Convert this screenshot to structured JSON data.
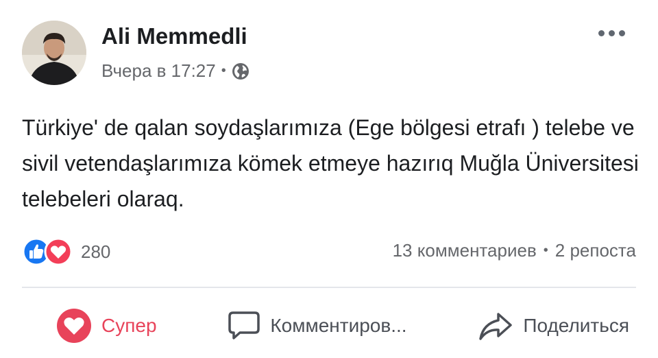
{
  "post": {
    "author": "Ali Memmedli",
    "time": "Вчера в 17:27",
    "separator": "•",
    "privacy_icon": "globe-icon",
    "text": "Türkiye' de qalan soydaşlarımıza (Ege bölgesi etrafı ) telebe ve sivil vetendaşlarımıza kömek etmeye hazırıq Muğla Üniversitesi telebeleri olaraq."
  },
  "reactions": {
    "icons": [
      "like-icon",
      "love-icon"
    ],
    "count": "280"
  },
  "stats": {
    "comments": "13 комментариев",
    "separator": "•",
    "shares": "2 репоста"
  },
  "actions": {
    "react_label": "Супер",
    "comment_label": "Комментиров...",
    "share_label": "Поделиться"
  },
  "colors": {
    "super": "#e8435a",
    "like_blue": "#1877f2",
    "love_red": "#f33e58",
    "secondary_text": "#65676b"
  }
}
